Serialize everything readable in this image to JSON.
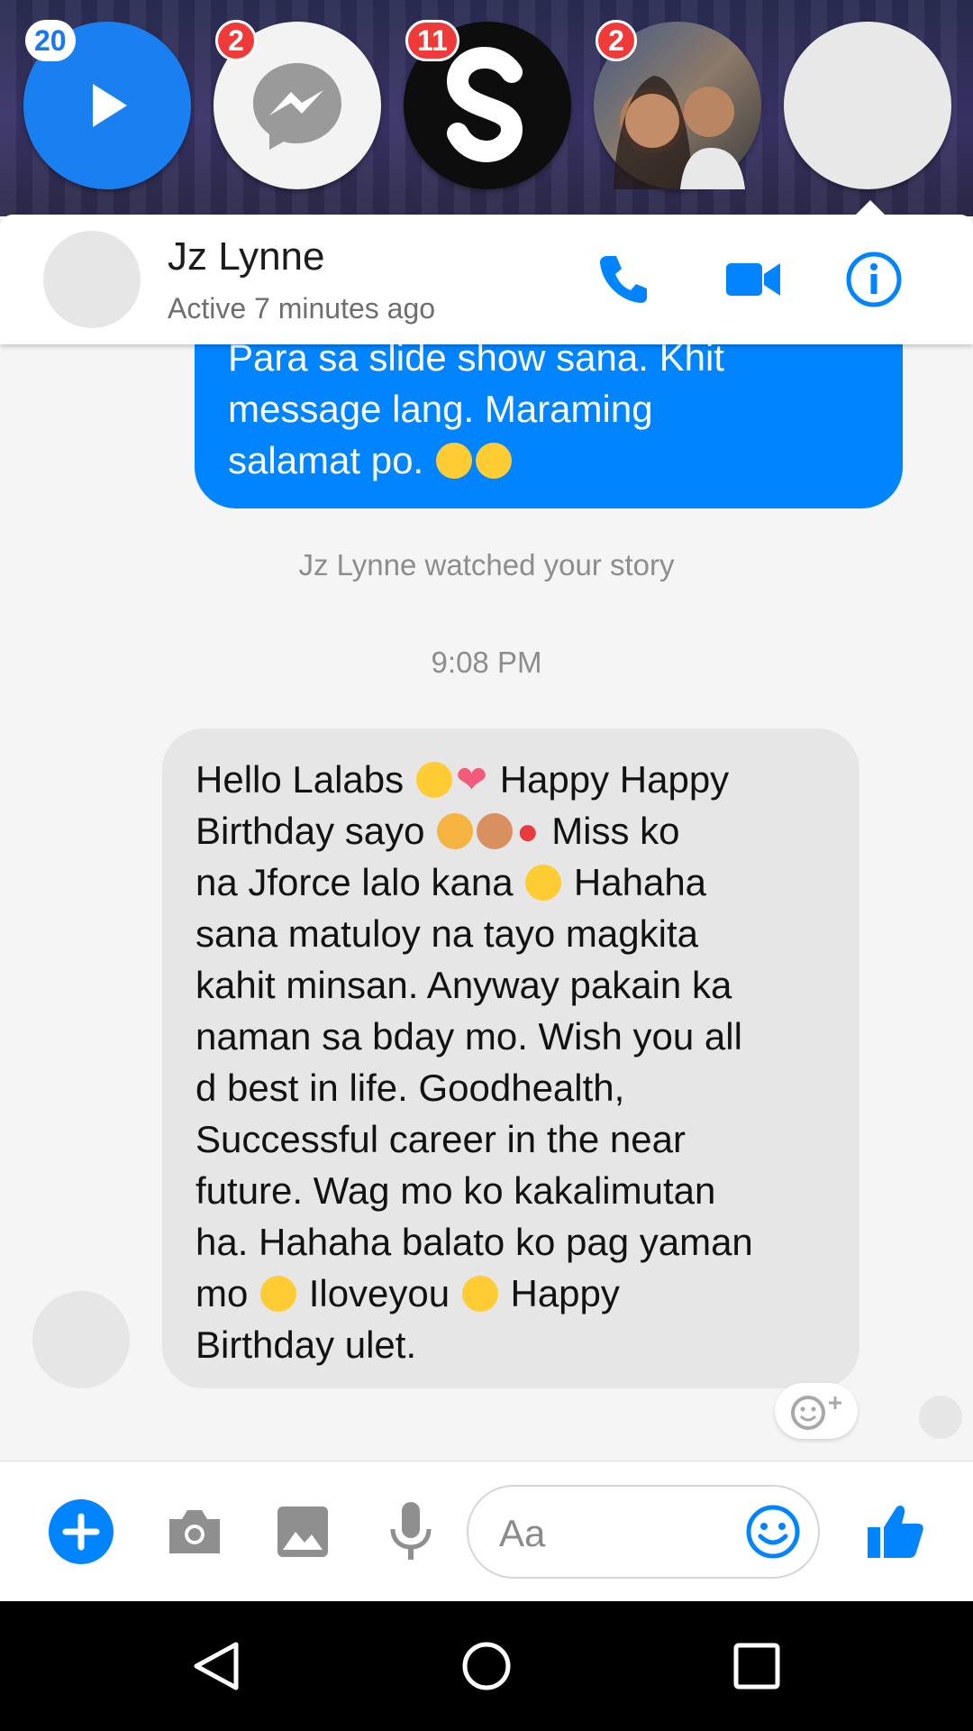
{
  "chat_heads": [
    {
      "badge": "20",
      "type": "video"
    },
    {
      "badge": "2",
      "type": "messenger"
    },
    {
      "badge": "11",
      "type": "s-app"
    },
    {
      "badge": "2",
      "type": "photo-contact"
    },
    {
      "badge": "",
      "type": "active-contact"
    }
  ],
  "header": {
    "name": "Jz Lynne",
    "status": "Active 7 minutes ago",
    "icons": [
      "phone-icon",
      "video-camera-icon",
      "info-icon"
    ]
  },
  "messages": {
    "outgoing": {
      "lines": [
        "Para sa slide show sana. Khit",
        "message lang. Maraming",
        "salamat po."
      ],
      "emoji": [
        "smiling-face-with-halo",
        "smiling-face-with-halo"
      ]
    },
    "story_notice": "Jz Lynne watched your story",
    "timestamp": "9:08 PM",
    "incoming": {
      "l1a": "Hello Lalabs",
      "l1b": "Happy Happy",
      "l2a": "Birthday sayo",
      "l2b": "Miss ko",
      "l3a": "na Jforce lalo kana",
      "l3b": "Hahaha",
      "l4": "sana matuloy na tayo magkita",
      "l5": "kahit minsan. Anyway pakain ka",
      "l6": "naman sa bday mo. Wish you all",
      "l7": "d best in life. Goodhealth,",
      "l8": "Successful career in the near",
      "l9": "future. Wag mo ko kakalimutan",
      "l10": "ha. Hahaha balato ko pag yaman",
      "l11a": "mo",
      "l11b": "Iloveyou",
      "l11c": "Happy",
      "l12": "Birthday ulet."
    }
  },
  "composer": {
    "placeholder": "Aa",
    "icons": [
      "plus-icon",
      "camera-icon",
      "image-icon",
      "microphone-icon",
      "emoji-icon",
      "thumbs-up-icon"
    ]
  },
  "navbar": {
    "icons": [
      "back-icon",
      "home-icon",
      "recents-icon"
    ]
  },
  "colors": {
    "accent": "#0084ff",
    "badge": "#f03a3a",
    "incoming_bubble": "#e6e6e6"
  }
}
